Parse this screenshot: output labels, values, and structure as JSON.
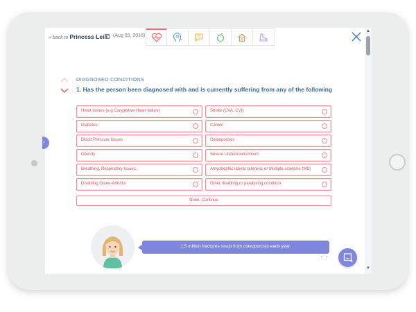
{
  "header": {
    "back_prefix": "« back to",
    "person_name": "Princess Leia",
    "date": "(Aug 26, 2016)",
    "tabs": [
      {
        "icon": "heart-icon",
        "active": true
      },
      {
        "icon": "head-icon",
        "active": false
      },
      {
        "icon": "chat-icon",
        "active": false
      },
      {
        "icon": "apple-icon",
        "active": false
      },
      {
        "icon": "home-icon",
        "active": false
      },
      {
        "icon": "shoe-icon",
        "active": false
      }
    ]
  },
  "section": {
    "title": "DIAGNOSED CONDITIONS",
    "question": "1.   Has the person been diagnosed with and is currently suffering from any of the following"
  },
  "options_left": [
    "Heart Issues (e.g Congestive Heart failure)",
    "Diabetes",
    "Blood Pressure Issues",
    "Obesity",
    "Breathing, Respiratory Issues",
    "Disabling Osteo-Arthritis"
  ],
  "options_right": [
    "Stroke (CVA, CVI)",
    "Cancer",
    "Osteoporosis",
    "Severe Undernourishment",
    "Amyotrophic lateral sclerosis or Multiple sclerosis (MS)",
    "Other disabling or paralysing condition"
  ],
  "none_button": "None, Continue",
  "fact": {
    "text": "1.5 million fractures result from osteoporosis each year.",
    "nav": "‹ ›"
  },
  "colors": {
    "accent": "#ef6c73",
    "option_text": "#e0535d",
    "question_blue": "#3b6a9c",
    "purple": "#7e86dd"
  }
}
